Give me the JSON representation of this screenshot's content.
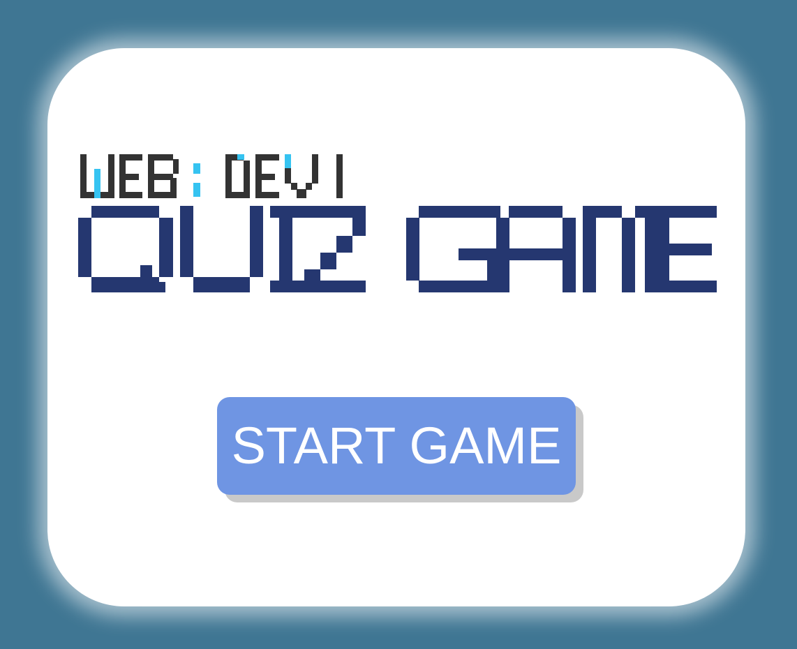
{
  "logo": {
    "line1_part1": "WEB",
    "line1_colon": ":",
    "line1_part2_d": "D",
    "line1_part2_rest": "E",
    "line1_part2_v": "V",
    "line2": "QUIZ GAME",
    "colors": {
      "dark": "#333333",
      "cyan": "#35c3f1",
      "navy": "#253770"
    }
  },
  "start_button": {
    "label": "START GAME",
    "color": "#6f95e3"
  },
  "colors": {
    "background": "#3f7693",
    "card": "#ffffff"
  }
}
